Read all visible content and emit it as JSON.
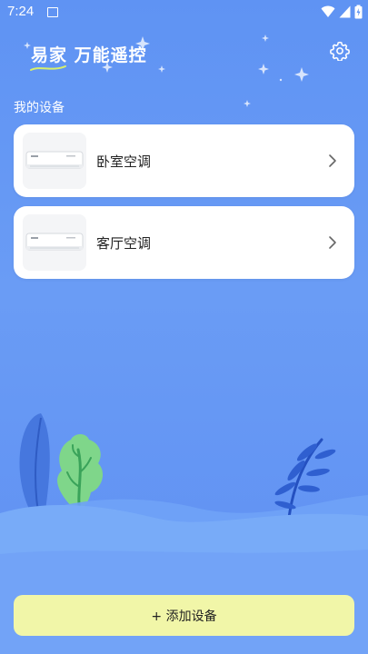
{
  "status_bar": {
    "time": "7:24"
  },
  "header": {
    "app_title": "易家 万能遥控"
  },
  "devices_section": {
    "title": "我的设备",
    "devices": [
      {
        "name": "卧室空调"
      },
      {
        "name": "客厅空调"
      }
    ]
  },
  "add_button": {
    "label": "+ 添加设备"
  },
  "colors": {
    "background": "#5f93f3",
    "card": "#ffffff",
    "add_button": "#f1f6a8"
  }
}
